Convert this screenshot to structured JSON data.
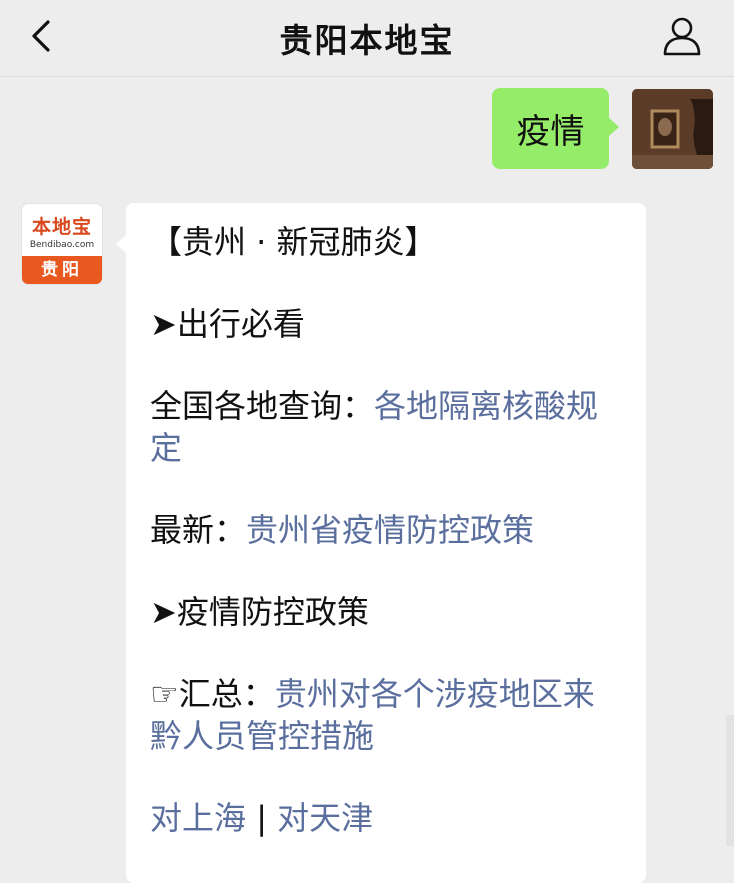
{
  "header": {
    "title": "贵阳本地宝",
    "icons": {
      "back": "chevron-left-icon",
      "profile": "person-icon"
    }
  },
  "outgoing": {
    "text": "疫情"
  },
  "account_avatar": {
    "logo_text": "本地宝",
    "logo_sub": "Bendibao.com",
    "city": "贵阳"
  },
  "incoming": {
    "heading": "【贵州 · 新冠肺炎】",
    "section1": "➤出行必看",
    "query_label": "全国各地查询：",
    "query_link": "各地隔离核酸规定",
    "latest_label": "最新：",
    "latest_link": "贵州省疫情防控政策",
    "section2": "➤疫情防控政策",
    "summary_prefix": "☞汇总：",
    "summary_link": "贵州对各个涉疫地区来黔人员管控措施",
    "link_shanghai": "对上海",
    "separator": " | ",
    "link_tianjin": "对天津"
  },
  "colors": {
    "link": "#5b6f9e",
    "outgoing_bubble": "#95ec69",
    "brand": "#e8581f"
  }
}
